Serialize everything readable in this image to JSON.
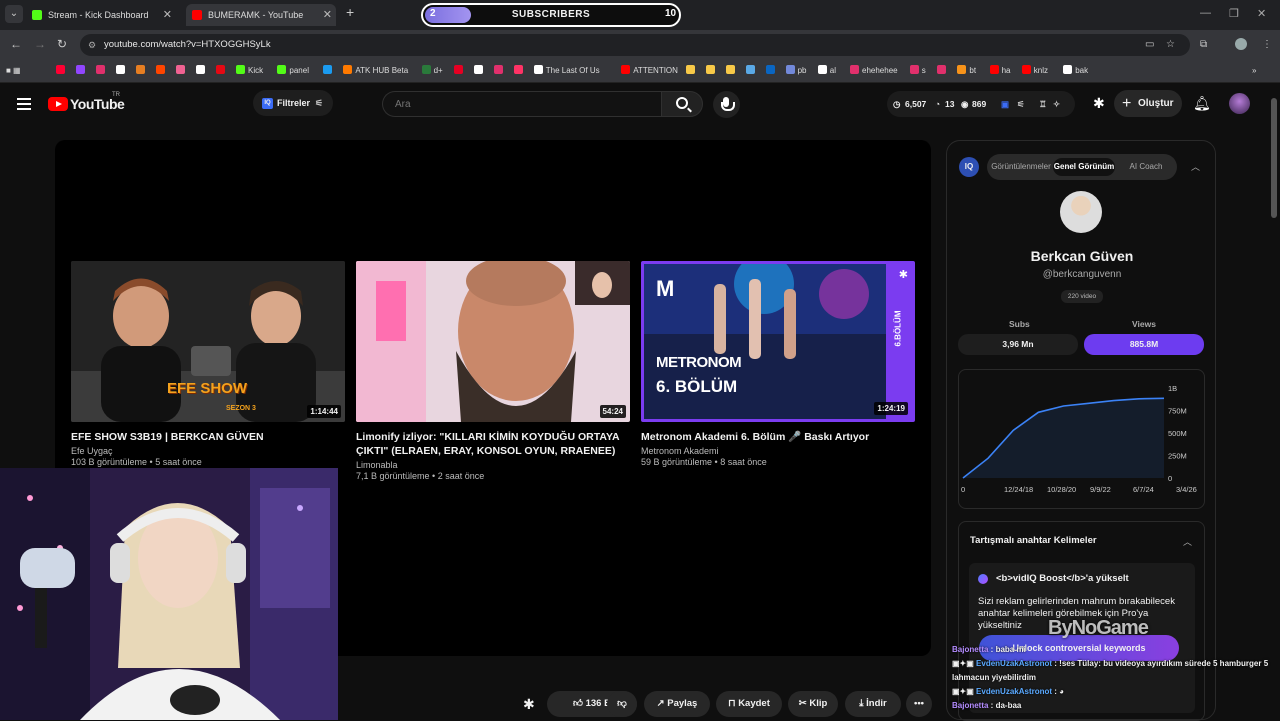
{
  "browser": {
    "tabs": [
      {
        "title": "Stream - Kick Dashboard",
        "icon": "kick-icon",
        "color": "#53fc18"
      },
      {
        "title": "BUMERAMK - YouTube",
        "icon": "youtube-icon",
        "color": "#ff0000"
      }
    ],
    "url": "youtube.com/watch?v=HTXOGGHSyLk"
  },
  "subs_widget": {
    "start": "2",
    "label": "SUBSCRIBERS",
    "goal": "10"
  },
  "bookmarks": [
    {
      "label": "",
      "color": "#ff0033"
    },
    {
      "label": "",
      "color": "#9146ff"
    },
    {
      "label": "",
      "color": "#e1306c"
    },
    {
      "label": "",
      "color": "#ffffff"
    },
    {
      "label": "",
      "color": "#e67e22"
    },
    {
      "label": "",
      "color": "#ff4500"
    },
    {
      "label": "",
      "color": "#f06292"
    },
    {
      "label": "",
      "color": "#ffffff"
    },
    {
      "label": "",
      "color": "#e50914"
    },
    {
      "label": "Kick",
      "color": "#53fc18"
    },
    {
      "label": "panel",
      "color": "#53fc18"
    },
    {
      "label": "",
      "color": "#1b9bf0"
    },
    {
      "label": "ATK HUB Beta",
      "color": "#ff7a00"
    },
    {
      "label": "d+",
      "color": "#2a7a3b"
    },
    {
      "label": "",
      "color": "#e60023"
    },
    {
      "label": "",
      "color": "#ffffff"
    },
    {
      "label": "",
      "color": "#e1306c"
    },
    {
      "label": "",
      "color": "#ff3366"
    },
    {
      "label": "The Last Of Us",
      "color": "#ffffff"
    },
    {
      "label": "ATTENTION",
      "color": "#ff0000"
    },
    {
      "label": "",
      "color": "#f7c948"
    },
    {
      "label": "",
      "color": "#f7c948"
    },
    {
      "label": "",
      "color": "#f7c948"
    },
    {
      "label": "",
      "color": "#5aa9e6"
    },
    {
      "label": "",
      "color": "#0a66c2"
    },
    {
      "label": "pb",
      "color": "#7289da"
    },
    {
      "label": "al",
      "color": "#ffffff"
    },
    {
      "label": "ehehehee",
      "color": "#e1306c"
    },
    {
      "label": "s",
      "color": "#e1306c"
    },
    {
      "label": "",
      "color": "#e1306c"
    },
    {
      "label": "bt",
      "color": "#f7931a"
    },
    {
      "label": "ha",
      "color": "#ff0000"
    },
    {
      "label": "knlz",
      "color": "#ff0000"
    },
    {
      "label": "bak",
      "color": "#ffffff"
    }
  ],
  "yt": {
    "logo": "YouTube",
    "country": "TR",
    "filters": "Filtreler",
    "search_placeholder": "Ara",
    "stats": {
      "views": "6,507",
      "count": "13",
      "subs": "869"
    },
    "create": "Oluştur"
  },
  "endcards": [
    {
      "title": "EFE SHOW S3B19 | BERKCAN GÜVEN",
      "channel": "Efe Uygaç",
      "meta": "103 B görüntüleme • 5 saat önce",
      "duration": "1:14:44",
      "overlay_title": "EFE SHOW",
      "overlay_sub": "SEZON 3"
    },
    {
      "title": "Limonify izliyor: \"KILLARI KİMİN KOYDUĞU ORTAYA ÇIKTI\" (ELRAEN, ERAY, KONSOL OYUN, RRAENEE)",
      "channel": "Limonabla",
      "meta": "7,1 B görüntüleme • 2 saat önce",
      "duration": "54:24"
    },
    {
      "title": "Metronom Akademi 6. Bölüm 🎤 Baskı Artıyor",
      "channel": "Metronom Akademi",
      "meta": "59 B görüntüleme • 8 saat önce",
      "duration": "1:24:19",
      "overlay_title": "METRONOM",
      "overlay_sub": "6. BÖLÜM",
      "overlay_side": "6.BÖLÜM",
      "overlay_logo": "M"
    }
  ],
  "actions": {
    "likes": "136 B",
    "share": "Paylaş",
    "save": "Kaydet",
    "clip": "Klip",
    "download": "İndir"
  },
  "iq": {
    "badge": "IQ",
    "tabs": [
      "Görüntülenmeler",
      "Genel Görünüm",
      "AI Coach"
    ],
    "name": "Berkcan Güven",
    "handle": "@berkcanguvenn",
    "video_count": "220 video",
    "subs_label": "Subs",
    "subs_value": "3,96 Mn",
    "views_label": "Views",
    "views_value": "885.8M",
    "keywords_title": "Tartışmalı anahtar Kelimeler",
    "boost_title": "<b>vidIQ Boost</b>'a yükselt",
    "boost_desc": "Sizi reklam gelirlerinden mahrum bırakabilecek anahtar kelimeleri görebilmek için Pro'ya yükseltiniz",
    "unlock": "Unlock controversial keywords"
  },
  "chart_data": {
    "type": "area",
    "x": [
      "0",
      "12/24/18",
      "10/28/20",
      "9/9/22",
      "6/7/24",
      "3/4/26"
    ],
    "y": [
      0,
      220,
      530,
      730,
      800,
      830,
      860,
      880,
      885.8
    ],
    "yticks": [
      "0",
      "250M",
      "500M",
      "750M",
      "1B"
    ],
    "ylim": [
      0,
      1000
    ],
    "color": "#3b82f6"
  },
  "chat": [
    {
      "user": "Bajonetta",
      "msg": "baba mi",
      "color": "#b48cff"
    },
    {
      "user": "EvdenUzakAstronot",
      "msg": "!ses Tülay: bu videoya ayırdıkım sürede 5 hamburger 5 lahmacun yiyebilirdim",
      "color": "#5aa9ff"
    },
    {
      "user": "EvdenUzakAstronot",
      "msg": "",
      "color": "#5aa9ff"
    },
    {
      "user": "Bajonetta",
      "msg": "da-baa",
      "color": "#b48cff"
    }
  ],
  "watermark": "ByNoGame"
}
